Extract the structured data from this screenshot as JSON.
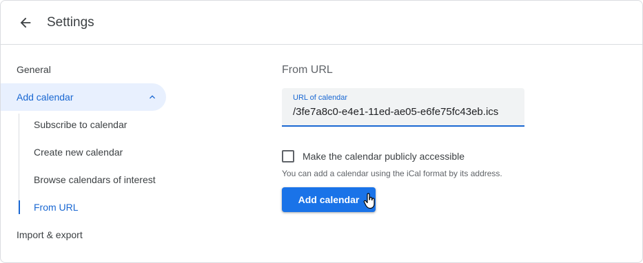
{
  "header": {
    "title": "Settings",
    "back_icon": "arrow-back-icon"
  },
  "sidebar": {
    "items": [
      {
        "label": "General"
      },
      {
        "label": "Add calendar",
        "expanded": true
      },
      {
        "label": "Import & export"
      }
    ],
    "sub_items": [
      {
        "label": "Subscribe to calendar"
      },
      {
        "label": "Create new calendar"
      },
      {
        "label": "Browse calendars of interest"
      },
      {
        "label": "From URL",
        "active": true
      }
    ]
  },
  "main": {
    "section_title": "From URL",
    "url_field": {
      "label": "URL of calendar",
      "value": "/3fe7a8c0-e4e1-11ed-ae05-e6fe75fc43eb.ics"
    },
    "public_checkbox": {
      "label": "Make the calendar publicly accessible",
      "checked": false
    },
    "helper_text": "You can add a calendar using the iCal format by its address.",
    "add_button": "Add calendar"
  },
  "colors": {
    "accent": "#1a73e8",
    "active_bg": "#e8f0fe",
    "active_text": "#1967d2"
  }
}
